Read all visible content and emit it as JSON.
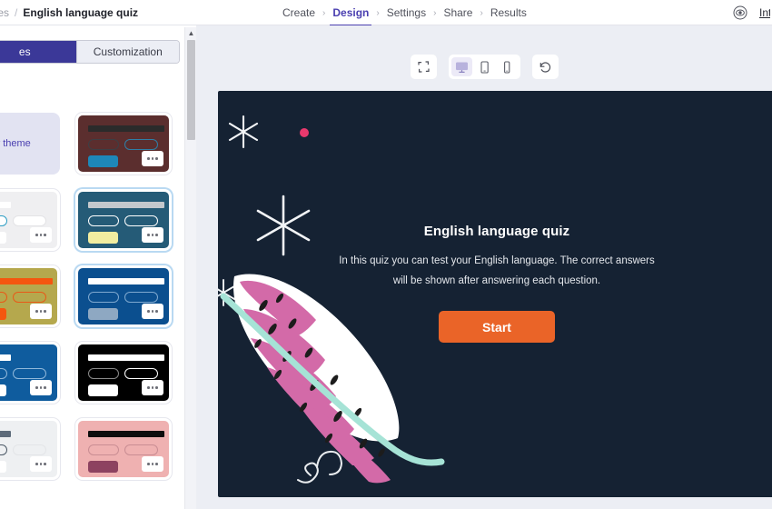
{
  "breadcrumb": {
    "parent": "plates",
    "separator": "/",
    "current": "English language quiz"
  },
  "nav": {
    "chevron": "›",
    "items": [
      {
        "label": "Create",
        "active": false
      },
      {
        "label": "Design",
        "active": true
      },
      {
        "label": "Settings",
        "active": false
      },
      {
        "label": "Share",
        "active": false
      },
      {
        "label": "Results",
        "active": false
      }
    ]
  },
  "topright": {
    "preview_icon": "eye-icon",
    "integrate_label": "Integrate"
  },
  "sidebar": {
    "tabs": [
      {
        "label": "es",
        "active": true
      },
      {
        "label": "Customization",
        "active": false
      }
    ],
    "new_theme_label": "w theme",
    "menu_glyph": "•••",
    "themes": [
      {
        "name": "new-theme",
        "kind": "new"
      },
      {
        "name": "theme-maroon",
        "bg": "#5b2e2e",
        "title": "#2b2b2b",
        "pill1_border": "#3c3f45",
        "pill1_fill": "transparent",
        "pill2_border": "#2f7ea6",
        "pill2_fill": "transparent",
        "button": "#1e87b8",
        "selected": false
      },
      {
        "name": "theme-light-grey",
        "bg": "#efeff1",
        "title": "#ffffff",
        "pill1_border": "#2f9ec4",
        "pill1_fill": "#ffffff",
        "pill2_border": "#e3e3e6",
        "pill2_fill": "#ffffff",
        "button": "#ffffff",
        "selected": false
      },
      {
        "name": "theme-steel-blue",
        "bg": "#255b77",
        "title": "#c4c8cc",
        "pill1_border": "#ffffff",
        "pill1_fill": "transparent",
        "pill2_border": "#ffffff",
        "pill2_fill": "transparent",
        "button": "#f2eda0",
        "selected": true
      },
      {
        "name": "theme-olive",
        "bg": "#b5a84d",
        "title": "#f4560f",
        "pill1_border": "#e85a18",
        "pill1_fill": "transparent",
        "pill2_border": "#e85a18",
        "pill2_fill": "transparent",
        "button": "#f4560f",
        "selected": false
      },
      {
        "name": "theme-navy",
        "bg": "#0b4f8f",
        "title": "#ffffff",
        "pill1_border": "#7fa8cf",
        "pill1_fill": "transparent",
        "pill2_border": "#7fa8cf",
        "pill2_fill": "transparent",
        "button": "#8ea8c2",
        "selected": true
      },
      {
        "name": "theme-blue",
        "bg": "#0f5c9e",
        "title": "#ffffff",
        "pill1_border": "#8fb7da",
        "pill1_fill": "transparent",
        "pill2_border": "#8fb7da",
        "pill2_fill": "transparent",
        "button": "#ffffff",
        "selected": false
      },
      {
        "name": "theme-black",
        "bg": "#000000",
        "title": "#ffffff",
        "pill1_border": "#8a8a8a",
        "pill1_fill": "transparent",
        "pill2_border": "#ffffff",
        "pill2_fill": "transparent",
        "button": "#ffffff",
        "selected": false
      },
      {
        "name": "theme-white",
        "bg": "#eef0f2",
        "title": "#5d6b7a",
        "pill1_border": "#4b5866",
        "pill1_fill": "transparent",
        "pill2_border": "#e3e5e8",
        "pill2_fill": "transparent",
        "button": "#ffffff",
        "selected": false
      },
      {
        "name": "theme-pink",
        "bg": "#efb1b1",
        "title": "#0d0d0d",
        "pill1_border": "#c98d93",
        "pill1_fill": "transparent",
        "pill2_border": "#c98d93",
        "pill2_fill": "transparent",
        "button": "#8d4260",
        "selected": false
      }
    ]
  },
  "toolbar": {
    "fullscreen_icon": "fullscreen-icon",
    "desktop_icon": "desktop-icon",
    "tablet_icon": "tablet-icon",
    "mobile_icon": "mobile-icon",
    "reset_icon": "reset-icon",
    "active_device": "desktop"
  },
  "preview": {
    "background": "#152233",
    "title": "English language quiz",
    "description": "In this quiz you can test your English language. The correct answers will be shown after answering each question.",
    "start_label": "Start",
    "start_color": "#ea6428",
    "accent_dot_color": "#e8396d",
    "feather_colors": {
      "vane": "#ffffff",
      "stripe": "#d36aa8",
      "quill": "#a6e3d6",
      "speck": "#1c1c1c"
    }
  },
  "scrollbar": {
    "up_arrow": "▲"
  }
}
